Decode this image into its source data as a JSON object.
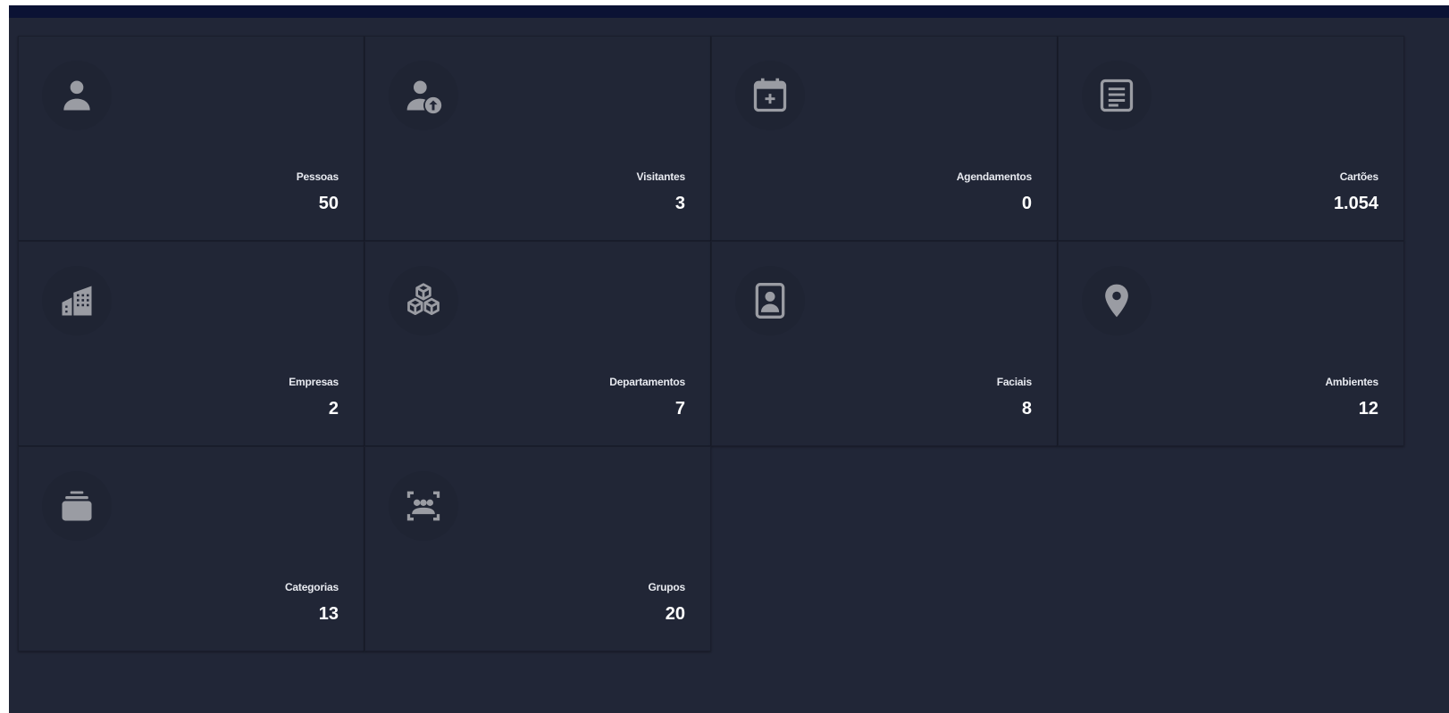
{
  "colors": {
    "background": "#212637",
    "topbar": "#0b1234",
    "icon": "#9a9ca3",
    "text": "#ffffff"
  },
  "cards": [
    {
      "label": "Pessoas",
      "value": "50",
      "icon": "person-icon"
    },
    {
      "label": "Visitantes",
      "value": "3",
      "icon": "person-upload-icon"
    },
    {
      "label": "Agendamentos",
      "value": "0",
      "icon": "calendar-add-icon"
    },
    {
      "label": "Cartões",
      "value": "1.054",
      "icon": "card-list-icon"
    },
    {
      "label": "Empresas",
      "value": "2",
      "icon": "building-icon"
    },
    {
      "label": "Departamentos",
      "value": "7",
      "icon": "cubes-icon"
    },
    {
      "label": "Faciais",
      "value": "8",
      "icon": "face-badge-icon"
    },
    {
      "label": "Ambientes",
      "value": "12",
      "icon": "location-pin-icon"
    },
    {
      "label": "Categorias",
      "value": "13",
      "icon": "stacked-folder-icon"
    },
    {
      "label": "Grupos",
      "value": "20",
      "icon": "group-scan-icon"
    }
  ]
}
